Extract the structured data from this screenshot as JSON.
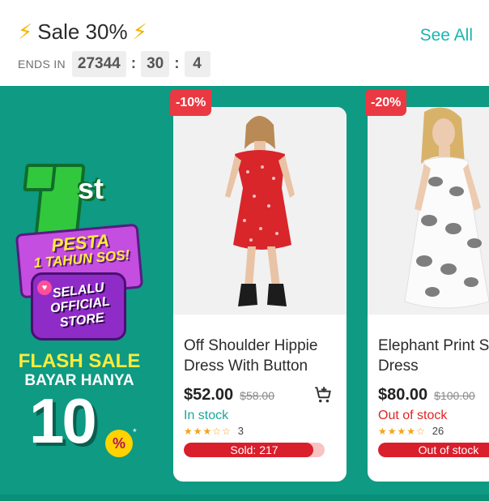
{
  "header": {
    "title": "Sale 30%",
    "bolt_icon": "⚡",
    "see_all": "See All",
    "ends_in": "ENDS IN",
    "timer": {
      "hours": "27344",
      "minutes": "30",
      "seconds": "4"
    }
  },
  "banner": {
    "rank": "st",
    "pesta_line1": "PESTA",
    "pesta_line2": "1 TAHUN SOS!",
    "store_line1": "SELALU",
    "store_line2": "OFFICIAL",
    "store_line3": "STORE",
    "flash_sale": "FLASH SALE",
    "bayar": "BAYAR HANYA",
    "number": "10",
    "percent": "%",
    "asterisk": "*"
  },
  "products": [
    {
      "discount": "-10%",
      "name": "Off Shoulder Hippie Dress With Button",
      "price": "$52.00",
      "old_price": "$58.00",
      "stock": "In stock",
      "stock_color": "#18a99a",
      "rating": 3,
      "stars": "★★★☆☆",
      "reviews": "3",
      "bar_label": "Sold: 217",
      "bar_fraction": 0.92
    },
    {
      "discount": "-20%",
      "name": "Elephant Print Swing Dress",
      "price": "$80.00",
      "old_price": "$100.00",
      "stock": "Out of stock",
      "stock_color": "#e02424",
      "rating": 3.5,
      "stars": "★★★★☆",
      "reviews": "26",
      "bar_label": "Out of stock",
      "bar_fraction": 1.0
    }
  ],
  "colors": {
    "accent": "#19b5b0",
    "promo_bg": "#0e9a83",
    "discount_badge": "#ea3943",
    "sold_bar": "#d91e2c"
  }
}
